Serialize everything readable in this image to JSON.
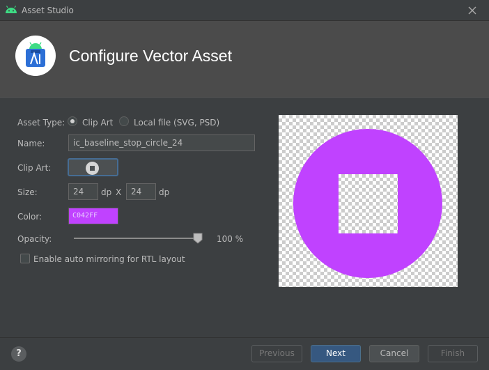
{
  "window": {
    "title": "Asset Studio",
    "app_icon": "android-icon",
    "close_icon": "close-icon"
  },
  "header": {
    "title": "Configure Vector Asset",
    "logo_icon": "android-studio-logo-icon"
  },
  "form": {
    "asset_type_label": "Asset Type:",
    "asset_type_options": [
      {
        "label": "Clip Art",
        "selected": true
      },
      {
        "label": "Local file (SVG, PSD)",
        "selected": false
      }
    ],
    "name_label": "Name:",
    "name_value": "ic_baseline_stop_circle_24",
    "clip_art_label": "Clip Art:",
    "clip_art_icon": "stop-circle-icon",
    "size_label": "Size:",
    "width_value": "24",
    "height_value": "24",
    "unit": "dp",
    "size_separator": "X",
    "color_label": "Color:",
    "color_value": "C042FF",
    "opacity_label": "Opacity:",
    "opacity_value": "100 %",
    "opacity_level": 1.0,
    "rtl_label": "Enable auto mirroring for RTL layout",
    "rtl_checked": false
  },
  "preview": {
    "icon": "stop-circle-icon",
    "color": "#c042ff"
  },
  "footer": {
    "help_label": "?",
    "previous_label": "Previous",
    "next_label": "Next",
    "cancel_label": "Cancel",
    "finish_label": "Finish"
  },
  "colors": {
    "accent": "#c042ff",
    "primary_button": "#365880",
    "focus_border": "#466d94"
  }
}
